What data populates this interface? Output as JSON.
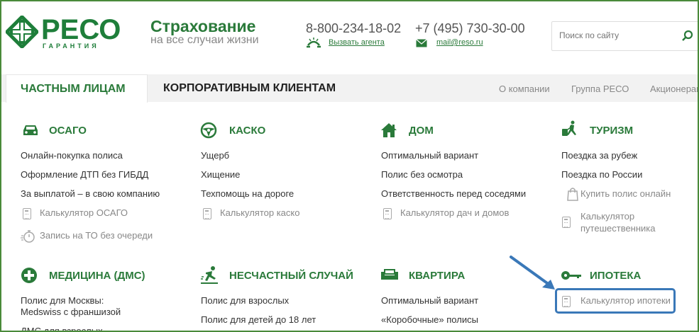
{
  "header": {
    "logo_text": "РЕСО",
    "logo_sub": "ГАРАНТИЯ",
    "tagline_main": "Страхование",
    "tagline_sub": "на все случаи жизни",
    "phone1": "8-800-234-18-02",
    "phone2": "+7 (495) 730-30-00",
    "call_agent": "Вызвать агента",
    "email": "mail@reso.ru",
    "search_placeholder": "Поиск по сайту",
    "brand_color": "#1e7e3a"
  },
  "nav": {
    "tab_private": "ЧАСТНЫМ ЛИЦАМ",
    "tab_corporate": "КОРПОРАТИВНЫМ КЛИЕНТАМ",
    "about": "О компании",
    "group": "Группа РЕСО",
    "shareholders": "Акционерам"
  },
  "categories": {
    "osago": {
      "title": "ОСАГО",
      "icon": "car-icon",
      "items": [
        "Онлайн-покупка полиса",
        "Оформление ДТП без ГИБДД",
        "За выплатой – в свою компанию"
      ],
      "calc": "Калькулятор ОСАГО",
      "to": "Запись на ТО без очереди"
    },
    "kasko": {
      "title": "КАСКО",
      "icon": "steering-wheel-icon",
      "items": [
        "Ущерб",
        "Хищение",
        "Техпомощь на дороге"
      ],
      "calc": "Калькулятор каско"
    },
    "dom": {
      "title": "ДОМ",
      "icon": "house-icon",
      "items": [
        "Оптимальный вариант",
        "Полис без осмотра",
        "Ответственность перед соседями"
      ],
      "calc": "Калькулятор дач и домов"
    },
    "turizm": {
      "title": "ТУРИЗМ",
      "icon": "traveler-icon",
      "items": [
        "Поездка за рубеж",
        "Поездка по России"
      ],
      "buy": "Купить полис онлайн",
      "calc_line1": "Калькулятор",
      "calc_line2": "путешественника"
    },
    "medicina": {
      "title": "МЕДИЦИНА (ДМС)",
      "icon": "medical-cross-icon",
      "item1_line1": "Полис для Москвы:",
      "item1_line2": "Medswiss с франшизой",
      "item2": "ДМС для взрослых"
    },
    "neschastny": {
      "title": "НЕСЧАСТНЫЙ СЛУЧАЙ",
      "icon": "accident-icon",
      "items": [
        "Полис для взрослых",
        "Полис для детей до 18 лет"
      ]
    },
    "kvartira": {
      "title": "КВАРТИРА",
      "icon": "sofa-icon",
      "items": [
        "Оптимальный вариант",
        "«Коробочные» полисы"
      ]
    },
    "ipoteka": {
      "title": "ИПОТЕКА",
      "icon": "key-icon",
      "calc": "Калькулятор ипотеки"
    }
  }
}
